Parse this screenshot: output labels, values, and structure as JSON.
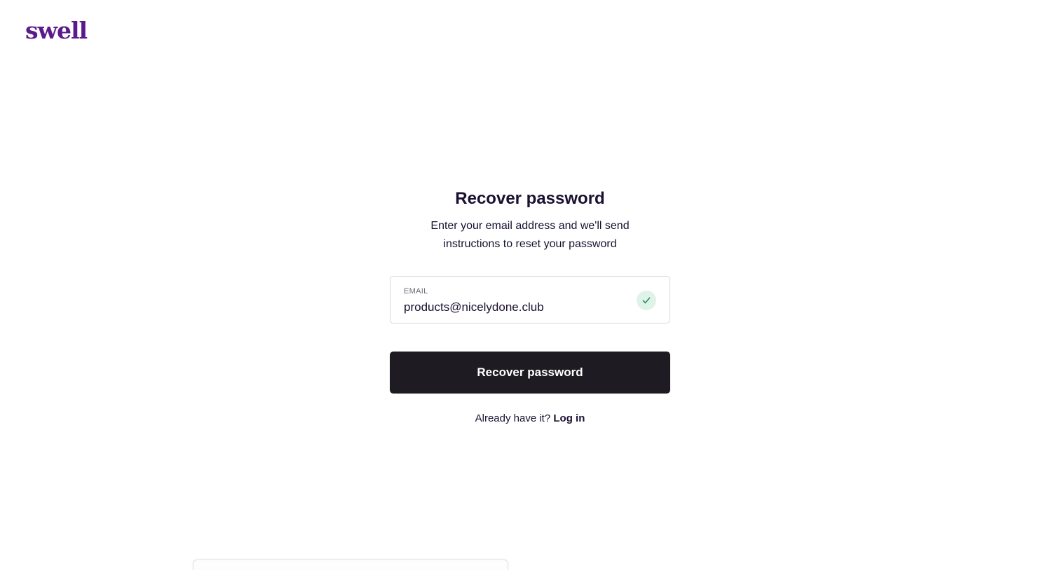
{
  "brand": {
    "logo_text": "swell",
    "color": "#5a1a8c"
  },
  "form": {
    "title": "Recover password",
    "subtitle": "Enter your email address and we'll send instructions to reset your password",
    "email": {
      "label": "EMAIL",
      "value": "products@nicelydone.club",
      "status_icon": "check-icon",
      "valid": true
    },
    "submit_label": "Recover password",
    "login_prompt": "Already have it?",
    "login_link": "Log in"
  },
  "colors": {
    "button_bg": "#1e1c22",
    "valid_badge_bg": "#dff3e9",
    "valid_check": "#2f8a5f"
  }
}
